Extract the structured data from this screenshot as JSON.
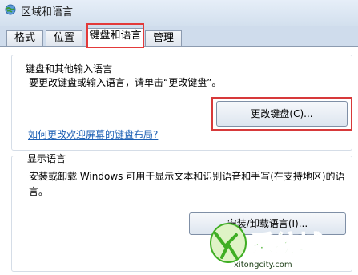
{
  "window": {
    "title": "区域和语言"
  },
  "tabs": [
    {
      "label": "格式"
    },
    {
      "label": "位置"
    },
    {
      "label": "键盘和语言"
    },
    {
      "label": "管理"
    }
  ],
  "keyboard_group": {
    "title": "键盘和其他输入语言",
    "description": "要更改键盘或输入语言，请单击“更改键盘”。",
    "change_button": "更改键盘(C)...",
    "help_link": "如何更改欢迎屏幕的键盘布局?"
  },
  "display_group": {
    "title": "显示语言",
    "description_line1": "安装或卸载 Windows 可用于显示文本和识别语音和手写(在支持地区)的语",
    "description_line2": "言。",
    "install_button": "安装/卸载语言(I)..."
  },
  "watermark": {
    "brand": "系统城",
    "domain": "xitongcity.com"
  },
  "colors": {
    "highlight_border": "#e33a3a",
    "link": "#1c5fb4",
    "watermark_green": "#3fae24"
  }
}
